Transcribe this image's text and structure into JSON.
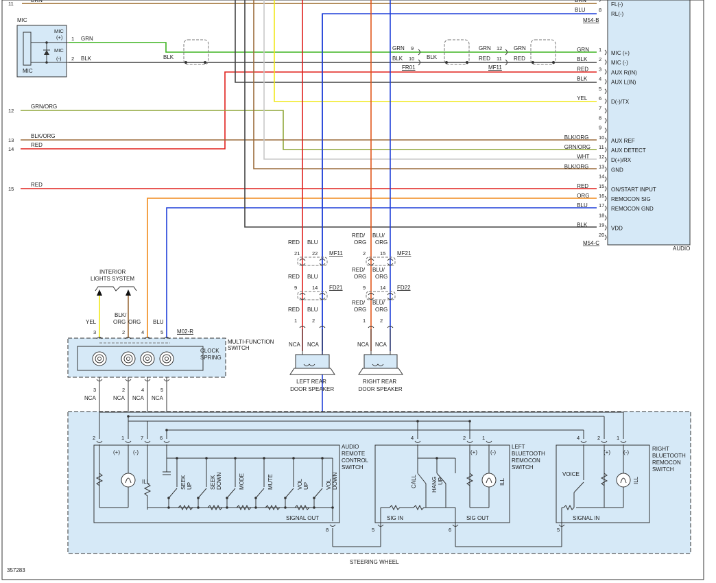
{
  "figure_id": "357283",
  "colors": {
    "grn": "#3bb41f",
    "blk": "#444444",
    "red": "#e0201c",
    "blu": "#1f3fd8",
    "yel": "#f0e81a",
    "org": "#f08a1a",
    "wht": "#c8c8c8",
    "brn": "#9c6a2a",
    "grnorg": "#8fa63a",
    "blkorg": "#9a6a3a",
    "redorg": "#e0561a"
  },
  "audio": {
    "label": "AUDIO",
    "connectors": {
      "b": "M54-B",
      "c": "M54-C"
    },
    "top_wires": [
      {
        "color": "BRN",
        "pin": "7",
        "func": "FL(-)"
      },
      {
        "color": "BLU",
        "pin": "8",
        "func": "RL(-)"
      }
    ],
    "pins": [
      {
        "pin": "1",
        "color": "GRN",
        "func": "MIC (+)"
      },
      {
        "pin": "2",
        "color": "BLK",
        "func": "MIC (-)"
      },
      {
        "pin": "3",
        "color": "RED",
        "func": "AUX R(IN)"
      },
      {
        "pin": "4",
        "color": "BLK",
        "func": "AUX L(IN)"
      },
      {
        "pin": "5",
        "color": "",
        "func": ""
      },
      {
        "pin": "6",
        "color": "YEL",
        "func": "D(-)/TX"
      },
      {
        "pin": "7",
        "color": "",
        "func": ""
      },
      {
        "pin": "8",
        "color": "",
        "func": ""
      },
      {
        "pin": "9",
        "color": "",
        "func": ""
      },
      {
        "pin": "10",
        "color": "BLK/ORG",
        "func": "AUX REF"
      },
      {
        "pin": "11",
        "color": "GRN/ORG",
        "func": "AUX DETECT"
      },
      {
        "pin": "12",
        "color": "WHT",
        "func": "D(+)/RX"
      },
      {
        "pin": "13",
        "color": "BLK/ORG",
        "func": "GND"
      },
      {
        "pin": "14",
        "color": "",
        "func": ""
      },
      {
        "pin": "15",
        "color": "RED",
        "func": "ON/START INPUT"
      },
      {
        "pin": "16",
        "color": "ORG",
        "func": "REMOCON SIG"
      },
      {
        "pin": "17",
        "color": "BLU",
        "func": "REMOCON GND"
      },
      {
        "pin": "18",
        "color": "",
        "func": ""
      },
      {
        "pin": "19",
        "color": "BLK",
        "func": "VDD"
      },
      {
        "pin": "20",
        "color": "",
        "func": ""
      }
    ]
  },
  "left_wires": [
    {
      "ref": "11",
      "color": "BRN"
    },
    {
      "ref": "12",
      "color": "GRN/ORG"
    },
    {
      "ref": "13",
      "color": "BLK/ORG"
    },
    {
      "ref": "14",
      "color": "RED"
    },
    {
      "ref": "15",
      "color": "RED"
    }
  ],
  "mic": {
    "title": "MIC",
    "bottom": "MIC",
    "plus": "MIC (+)",
    "minus": "MIC (-)",
    "pin_plus": "1",
    "pin_minus": "2",
    "plus_color": "GRN",
    "minus_color": "BLK",
    "plus_sym": "(+)",
    "minus_sym": "(-)",
    "mic_word": "MIC",
    "blk_label": "BLK"
  },
  "inline": {
    "fr01": {
      "name": "FR01",
      "p1": "9",
      "p2": "10",
      "c1": "GRN",
      "c2": "BLK",
      "o2": "BLK"
    },
    "mf11": {
      "name": "MF11",
      "p1": "12",
      "p2": "11",
      "c1l": "GRN",
      "c2l": "RED",
      "c1r": "GRN",
      "c2r": "RED"
    }
  },
  "left_speaker": {
    "name": "LEFT REAR DOOR SPEAKER",
    "l1": "LEFT REAR",
    "l2": "DOOR SPEAKER",
    "rows": [
      {
        "conn": "MF11",
        "p1": "21",
        "p2": "22",
        "c1": "RED",
        "c2": "BLU"
      },
      {
        "conn": "FD21",
        "p1": "9",
        "p2": "14",
        "c1": "RED",
        "c2": "BLU"
      },
      {
        "conn": "",
        "p1": "1",
        "p2": "2",
        "c1": "RED",
        "c2": "BLU"
      }
    ],
    "nca": [
      "NCA",
      "NCA"
    ]
  },
  "right_speaker": {
    "name": "RIGHT REAR DOOR SPEAKER",
    "l1": "RIGHT REAR",
    "l2": "DOOR SPEAKER",
    "rows": [
      {
        "conn": "MF21",
        "p1": "2",
        "p2": "15",
        "c1a": "RED/",
        "c1b": "ORG",
        "c2a": "BLU/",
        "c2b": "ORG"
      },
      {
        "conn": "FD22",
        "p1": "9",
        "p2": "14",
        "c1a": "RED/",
        "c1b": "ORG",
        "c2a": "BLU/",
        "c2b": "ORG"
      },
      {
        "conn": "",
        "p1": "1",
        "p2": "2",
        "c1a": "RED/",
        "c1b": "ORG",
        "c2a": "BLU/",
        "c2b": "ORG"
      }
    ],
    "nca": [
      "NCA",
      "NCA"
    ]
  },
  "interior": {
    "l1": "INTERIOR",
    "l2": "LIGHTS SYSTEM"
  },
  "mfs": {
    "connector": "M02-R",
    "name_l1": "MULTI-FUNCTION",
    "name_l2": "SWITCH",
    "clock_l1": "CLOCK",
    "clock_l2": "SPRING",
    "pins": [
      {
        "pin": "3",
        "ca": "YEL",
        "cb": ""
      },
      {
        "pin": "2",
        "ca": "BLK/",
        "cb": "ORG"
      },
      {
        "pin": "4",
        "ca": "ORG",
        "cb": ""
      },
      {
        "pin": "5",
        "ca": "BLU",
        "cb": ""
      }
    ],
    "nca": [
      "3",
      "2",
      "4",
      "5"
    ],
    "nca_word": "NCA"
  },
  "steering": {
    "label": "STEERING WHEEL",
    "audio_remote": {
      "l1": "AUDIO",
      "l2": "REMOTE",
      "l3": "CONTROL",
      "l4": "SWITCH",
      "pins": [
        "2",
        "1",
        "7",
        "6"
      ],
      "out_pin": "8",
      "plus": "(+)",
      "minus": "(-)",
      "ill": "ILL",
      "switches": [
        [
          "SEEK",
          "UP"
        ],
        [
          "SEEK",
          "DOWN"
        ],
        [
          "MODE",
          ""
        ],
        [
          "MUTE",
          ""
        ],
        [
          "VOL",
          "UP"
        ],
        [
          "VOL",
          "DOWN"
        ]
      ],
      "signal": "SIGNAL OUT"
    },
    "left_bt": {
      "l1": "LEFT",
      "l2": "BLUETOOTH",
      "l3": "REMOCON",
      "l4": "SWITCH",
      "pins": [
        "4",
        "2",
        "1"
      ],
      "in_pin": "5",
      "out_pin": "6",
      "plus": "(+)",
      "minus": "(-)",
      "ill": "ILL",
      "call": "CALL",
      "hang1": "HANG",
      "hang2": "UP",
      "sig_in": "SIG IN",
      "sig_out": "SIG OUT"
    },
    "right_bt": {
      "l1": "RIGHT",
      "l2": "BLUETOOTH",
      "l3": "REMOCON",
      "l4": "SWITCH",
      "pins": [
        "4",
        "2",
        "1"
      ],
      "in_pin": "5",
      "plus": "(+)",
      "minus": "(-)",
      "ill": "ILL",
      "voice": "VOICE",
      "signal": "SIGNAL IN"
    }
  }
}
